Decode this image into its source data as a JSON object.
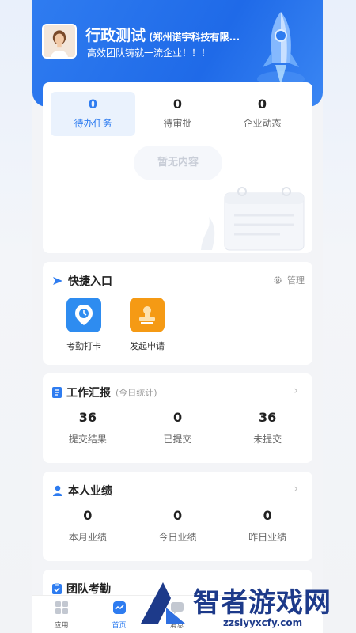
{
  "header": {
    "org_name": "行政测试",
    "company": "(郑州诺宇科技有限...",
    "slogan": "高效团队铸就一流企业！！！",
    "avatar_icon": "user-avatar"
  },
  "tasks": {
    "tabs": [
      {
        "count": "0",
        "label": "待办任务",
        "active": true
      },
      {
        "count": "0",
        "label": "待审批",
        "active": false
      },
      {
        "count": "0",
        "label": "企业动态",
        "active": false
      }
    ],
    "empty_text": "暂无内容"
  },
  "quick_entry": {
    "title": "快捷入口",
    "manage_label": "管理",
    "items": [
      {
        "label": "考勤打卡",
        "icon": "clock-icon",
        "color": "#2e8cf0"
      },
      {
        "label": "发起申请",
        "icon": "stamp-icon",
        "color": "#f59a14"
      }
    ]
  },
  "work_report": {
    "title": "工作汇报",
    "subtitle": "(今日统计)",
    "stats": [
      {
        "value": "36",
        "label": "提交结果"
      },
      {
        "value": "0",
        "label": "已提交"
      },
      {
        "value": "36",
        "label": "未提交"
      }
    ]
  },
  "performance": {
    "title": "本人业绩",
    "stats": [
      {
        "value": "0",
        "label": "本月业绩"
      },
      {
        "value": "0",
        "label": "今日业绩"
      },
      {
        "value": "0",
        "label": "昨日业绩"
      }
    ]
  },
  "attendance": {
    "title": "团队考勤"
  },
  "tabbar": {
    "items": [
      {
        "label": "应用",
        "icon": "apps-grid-icon"
      },
      {
        "label": "首页",
        "icon": "home-icon",
        "active": true
      },
      {
        "label": "消息",
        "icon": "message-icon"
      }
    ]
  },
  "watermark": {
    "text": "智者游戏网",
    "url": "zzslyyxcfy.com"
  },
  "colors": {
    "primary": "#2e7cf0",
    "header_bg": "#1f6ae8",
    "orange": "#f59a14"
  }
}
